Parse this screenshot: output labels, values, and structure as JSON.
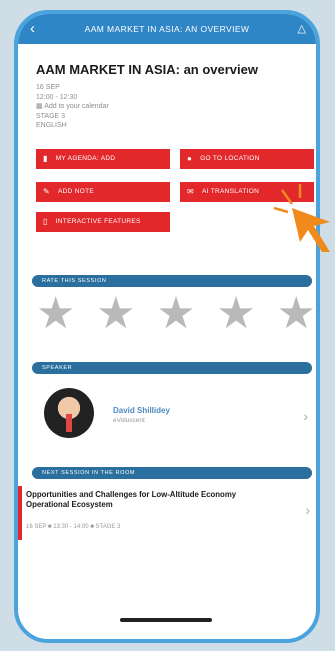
{
  "header": {
    "title": "AAM MARKET IN ASIA: AN OVERVIEW",
    "back_icon": "back-chevron-icon",
    "menu_icon": "filter-icon"
  },
  "event": {
    "title": "AAM MARKET IN ASIA: an overview",
    "date": "16 SEP",
    "time": "12:00 - 12:30",
    "add_calendar": "Add to your calendar",
    "stage": "STAGE 3",
    "language": "ENGLISH"
  },
  "actions": {
    "my_agenda": "MY AGENDA: ADD",
    "go_to_location": "GO TO LOCATION",
    "add_note": "ADD NOTE",
    "ai_translation": "AI TRANSLATION",
    "interactive_features": "INTERACTIVE FEATURES"
  },
  "rating": {
    "header": "RATE THIS SESSION",
    "stars": 5,
    "selected": 0
  },
  "speaker": {
    "header": "SPEAKER",
    "name": "David Shillidey",
    "organization": "eVoluscent"
  },
  "next_session": {
    "header": "NEXT SESSION IN THE ROOM",
    "title": "Opportunities and Challenges for Low-Altitude Economy Operational Ecosystem",
    "meta": "16 SEP ■ 13:30 - 14:00 ■ STAGE 3"
  },
  "colors": {
    "accent_red": "#e3282c",
    "header_blue": "#2f86c6",
    "section_blue": "#2a6f9e",
    "arrow_orange": "#f08a1c"
  }
}
